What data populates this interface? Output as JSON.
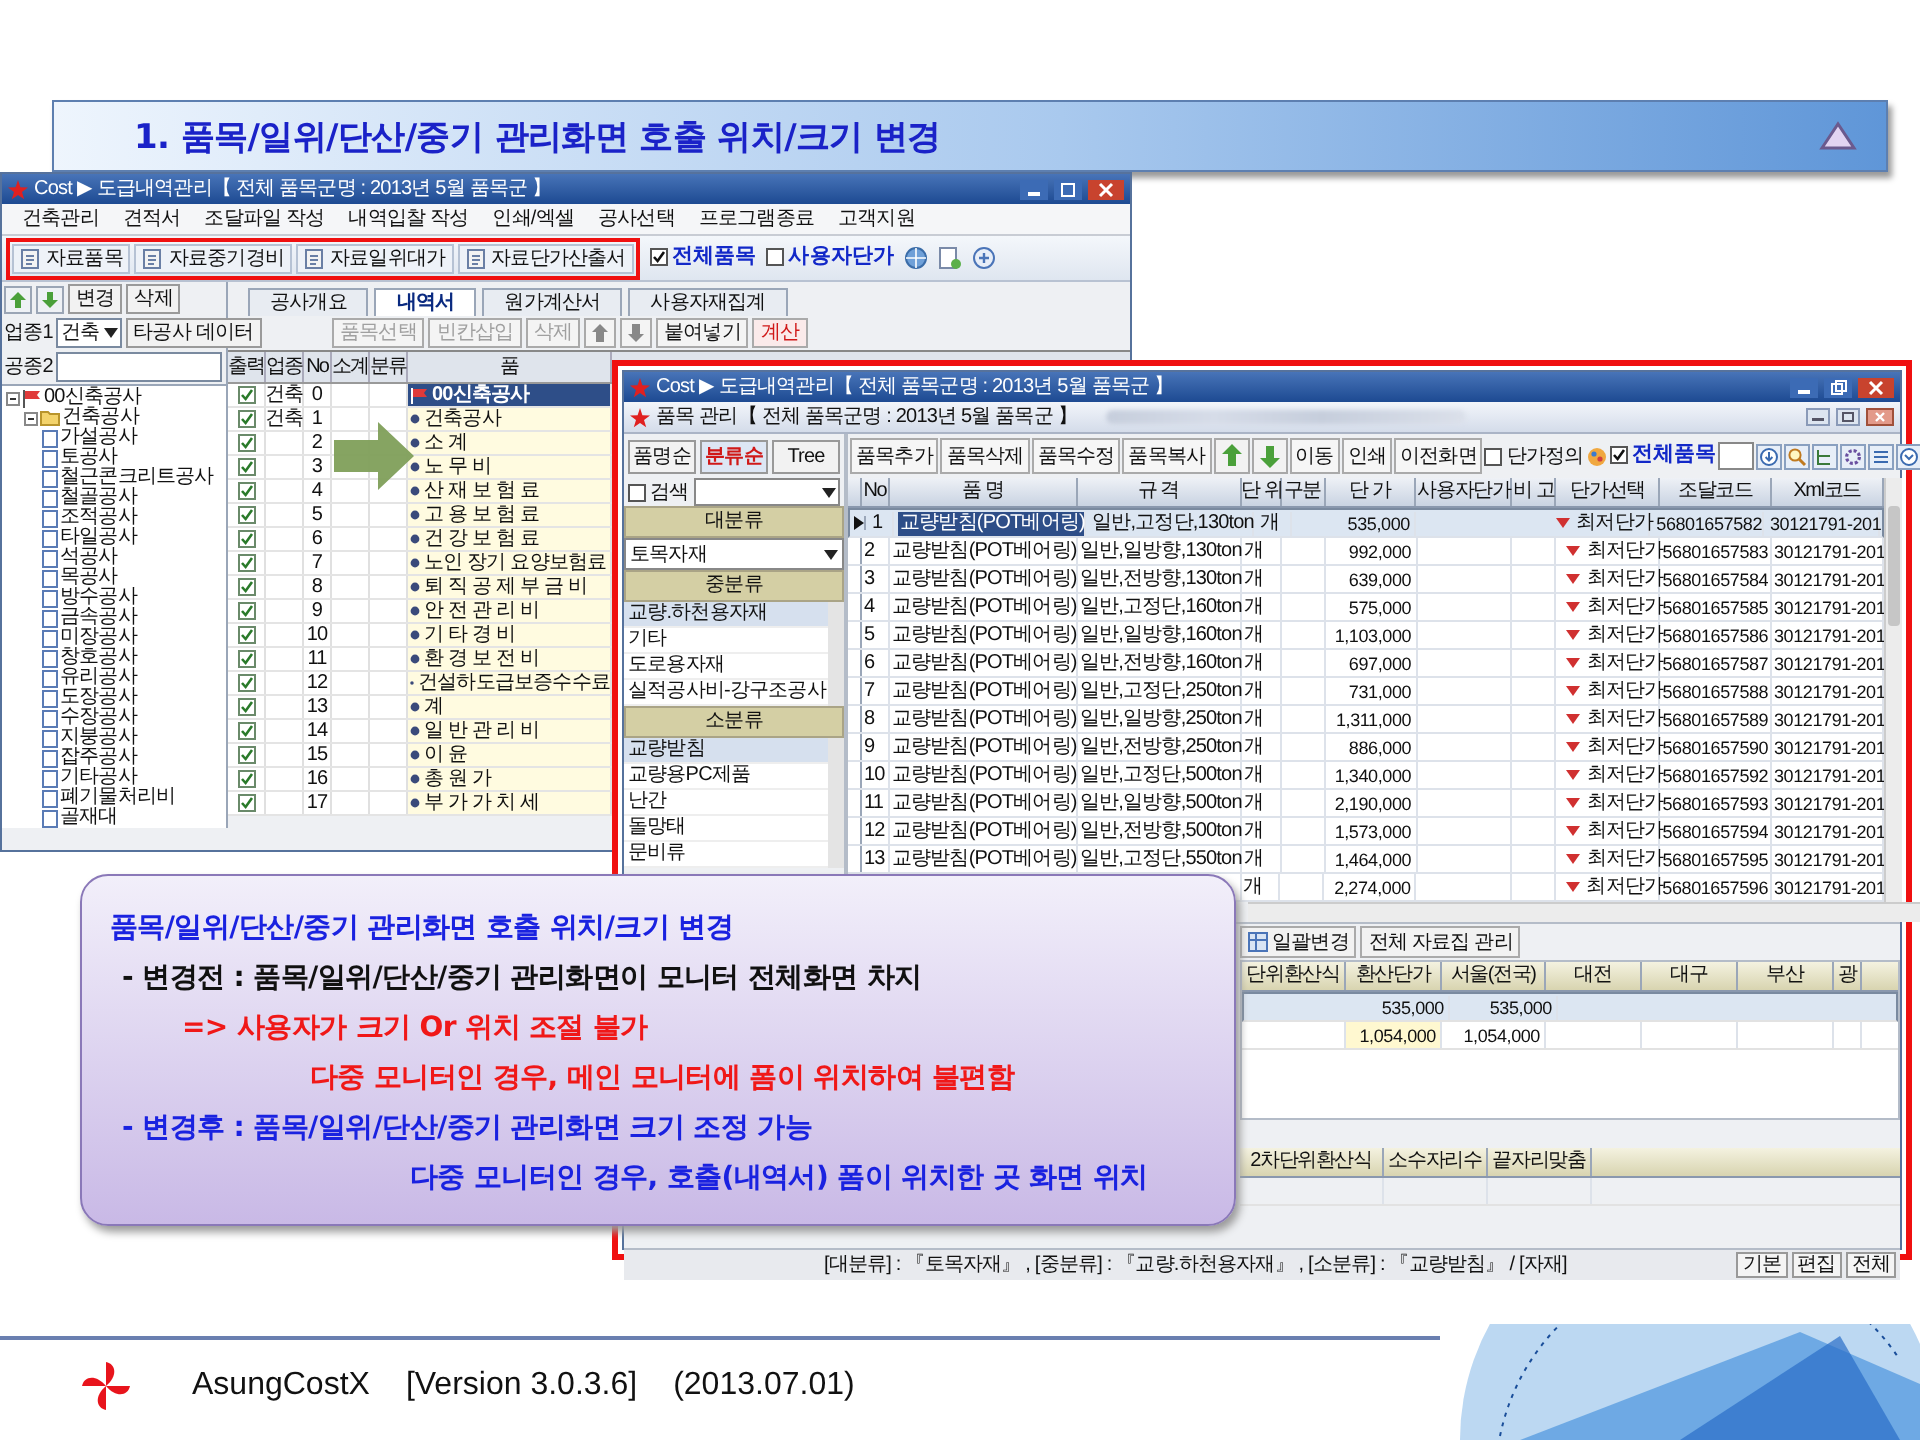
{
  "slide_title": "1. 품목/일위/단산/중기 관리화면 호출 위치/크기 변경",
  "back_window": {
    "title": "Cost ▶ 도급내역관리【 전체 품목군명 : 2013년 5월 품목군 】",
    "menu": [
      "건축관리",
      "견적서",
      "조달파일 작성",
      "내역입찰 작성",
      "인쇄/엑셀",
      "공사선택",
      "프로그램종료",
      "고객지원"
    ],
    "highlighted_buttons": [
      "자료품목",
      "자료중기경비",
      "자료일위대가",
      "자료단가산출서"
    ],
    "options": [
      {
        "label": "전체품목",
        "checked": true
      },
      {
        "label": "사용자단가",
        "checked": false
      }
    ],
    "side_buttons": [
      "변경",
      "삭제"
    ],
    "tabs": [
      {
        "label": "공사개요",
        "selected": false
      },
      {
        "label": "내역서",
        "selected": true
      },
      {
        "label": "원가계산서",
        "selected": false
      },
      {
        "label": "사용자재집계",
        "selected": false
      }
    ],
    "filter": {
      "label_1": "업종1",
      "value": "건축",
      "other_button": "타공사 데이터",
      "label_2": "공종2"
    },
    "grid_buttons": [
      {
        "kind": "button",
        "label": "품목선택",
        "disabled": true
      },
      {
        "kind": "button",
        "label": "빈칸삽입",
        "disabled": true
      },
      {
        "kind": "button",
        "label": "삭제",
        "disabled": true
      },
      {
        "kind": "up"
      },
      {
        "kind": "down"
      },
      {
        "kind": "button",
        "label": "붙여넣기",
        "disabled": false
      },
      {
        "kind": "accent",
        "label": "계산",
        "disabled": false
      }
    ],
    "tree": [
      {
        "label": "00신축공사",
        "expanded": true,
        "children": [
          {
            "label": "건축공사",
            "expanded": true,
            "children": [
              {
                "label": "가설공사"
              },
              {
                "label": "토공사"
              },
              {
                "label": "철근콘크리트공사"
              },
              {
                "label": "철골공사"
              },
              {
                "label": "조적공사"
              },
              {
                "label": "타일공사"
              },
              {
                "label": "석공사"
              },
              {
                "label": "목공사"
              },
              {
                "label": "방수공사"
              },
              {
                "label": "금속공사"
              },
              {
                "label": "미장공사"
              },
              {
                "label": "창호공사"
              },
              {
                "label": "유리공사"
              },
              {
                "label": "도장공사"
              },
              {
                "label": "수장공사"
              },
              {
                "label": "지붕공사"
              },
              {
                "label": "잡주공사"
              },
              {
                "label": "기타공사"
              },
              {
                "label": "폐기물처리비"
              },
              {
                "label": "골재대"
              }
            ]
          }
        ]
      }
    ],
    "grid": {
      "columns": [
        "출력",
        "업종",
        "No",
        "소계",
        "분류",
        "품"
      ],
      "rows": [
        {
          "kind": "project",
          "checked": true,
          "trade": "건축",
          "no": "0",
          "name": "00신축공사",
          "selected": true
        },
        {
          "kind": "item",
          "checked": true,
          "trade": "건축",
          "no": "1",
          "name": "건축공사",
          "selected": false
        },
        {
          "kind": "item",
          "checked": true,
          "no": "2",
          "name": "소 계",
          "selected": false
        },
        {
          "kind": "item",
          "checked": true,
          "no": "3",
          "name": "노 무 비",
          "selected": false
        },
        {
          "kind": "item",
          "checked": true,
          "no": "4",
          "name": "산 재 보 험 료",
          "selected": false
        },
        {
          "kind": "item",
          "checked": true,
          "no": "5",
          "name": "고 용 보 험 료",
          "selected": false
        },
        {
          "kind": "item",
          "checked": true,
          "no": "6",
          "name": "건 강 보 험 료",
          "selected": false
        },
        {
          "kind": "item",
          "checked": true,
          "no": "7",
          "name": "노인 장기 요양보험료",
          "selected": false
        },
        {
          "kind": "item",
          "checked": true,
          "no": "8",
          "name": "퇴 직 공 제 부 금 비",
          "selected": false
        },
        {
          "kind": "item",
          "checked": true,
          "no": "9",
          "name": "안 전 관 리 비",
          "selected": false
        },
        {
          "kind": "item",
          "checked": true,
          "no": "10",
          "name": "기 타 경 비",
          "selected": false
        },
        {
          "kind": "item",
          "checked": true,
          "no": "11",
          "name": "환 경 보 전 비",
          "selected": false
        },
        {
          "kind": "item",
          "checked": true,
          "no": "12",
          "name": "건설하도급보증수수료",
          "selected": false
        },
        {
          "kind": "item",
          "checked": true,
          "no": "13",
          "name": "계",
          "selected": false
        },
        {
          "kind": "item",
          "checked": true,
          "no": "14",
          "name": "일 반 관 리 비",
          "selected": false
        },
        {
          "kind": "item",
          "checked": true,
          "no": "15",
          "name": "이 윤",
          "selected": false
        },
        {
          "kind": "item",
          "checked": true,
          "no": "16",
          "name": "총 원 가",
          "selected": false
        },
        {
          "kind": "item",
          "checked": true,
          "no": "17",
          "name": "부 가 가 치 세",
          "selected": false
        }
      ]
    }
  },
  "front_window": {
    "title": "Cost ▶ 도급내역관리【 전체 품목군명 : 2013년 5월 품목군 】",
    "subtitle": "품목 관리【 전체 품목군명 : 2013년 5월 품목군 】",
    "sort_tabs": [
      {
        "label": "품명순",
        "selected": false
      },
      {
        "label": "분류순",
        "selected": true
      },
      {
        "label": "Tree",
        "selected": false
      }
    ],
    "search": {
      "label": "검색",
      "checked": false
    },
    "categories": [
      {
        "heading": "대분류",
        "kind": "dropdown",
        "value": "토목자재"
      },
      {
        "heading": "중분류",
        "kind": "list",
        "items": [
          {
            "label": "교량.하천용자재",
            "selected": true
          },
          {
            "label": "기타",
            "selected": false
          },
          {
            "label": "도로용자재",
            "selected": false
          },
          {
            "label": "실적공사비-강구조공사",
            "selected": false
          }
        ]
      },
      {
        "heading": "소분류",
        "kind": "list",
        "items": [
          {
            "label": "교량받침",
            "selected": true
          },
          {
            "label": "교량용PC제품",
            "selected": false
          },
          {
            "label": "난간",
            "selected": false
          },
          {
            "label": "돌망태",
            "selected": false
          },
          {
            "label": "문비류",
            "selected": false
          }
        ]
      }
    ],
    "toolbar": [
      {
        "kind": "button",
        "label": "품목추가"
      },
      {
        "kind": "button",
        "label": "품목삭제"
      },
      {
        "kind": "button",
        "label": "품목수정"
      },
      {
        "kind": "button",
        "label": "품목복사"
      },
      {
        "kind": "up"
      },
      {
        "kind": "down"
      },
      {
        "kind": "button",
        "label": "이동"
      },
      {
        "kind": "button",
        "label": "인쇄"
      },
      {
        "kind": "button",
        "label": "이전화면"
      }
    ],
    "options": [
      {
        "label": "단가정의",
        "checked": false
      },
      {
        "label": "전체품목",
        "checked": true
      }
    ],
    "grid": {
      "columns": [
        "No",
        "품 명",
        "규 격",
        "단 위",
        "구분",
        "단 가",
        "사용자단가",
        "비 고",
        "단가선택",
        "조달코드",
        "Xml코드"
      ],
      "rows": [
        {
          "no": "1",
          "name": "교량받침(POT베어링)",
          "spec": "일반,고정단,130ton",
          "unit": "개",
          "price": "535,000",
          "price_choice": "최저단가",
          "procurement_code": "56801657582",
          "xml_code": "30121791-201",
          "selected": true
        },
        {
          "no": "2",
          "name": "교량받침(POT베어링)",
          "spec": "일반,일방향,130ton",
          "unit": "개",
          "price": "992,000",
          "price_choice": "최저단가",
          "procurement_code": "56801657583",
          "xml_code": "30121791-201",
          "selected": false
        },
        {
          "no": "3",
          "name": "교량받침(POT베어링)",
          "spec": "일반,전방향,130ton",
          "unit": "개",
          "price": "639,000",
          "price_choice": "최저단가",
          "procurement_code": "56801657584",
          "xml_code": "30121791-201",
          "selected": false
        },
        {
          "no": "4",
          "name": "교량받침(POT베어링)",
          "spec": "일반,고정단,160ton",
          "unit": "개",
          "price": "575,000",
          "price_choice": "최저단가",
          "procurement_code": "56801657585",
          "xml_code": "30121791-201",
          "selected": false
        },
        {
          "no": "5",
          "name": "교량받침(POT베어링)",
          "spec": "일반,일방향,160ton",
          "unit": "개",
          "price": "1,103,000",
          "price_choice": "최저단가",
          "procurement_code": "56801657586",
          "xml_code": "30121791-201",
          "selected": false
        },
        {
          "no": "6",
          "name": "교량받침(POT베어링)",
          "spec": "일반,전방향,160ton",
          "unit": "개",
          "price": "697,000",
          "price_choice": "최저단가",
          "procurement_code": "56801657587",
          "xml_code": "30121791-201",
          "selected": false
        },
        {
          "no": "7",
          "name": "교량받침(POT베어링)",
          "spec": "일반,고정단,250ton",
          "unit": "개",
          "price": "731,000",
          "price_choice": "최저단가",
          "procurement_code": "56801657588",
          "xml_code": "30121791-201",
          "selected": false
        },
        {
          "no": "8",
          "name": "교량받침(POT베어링)",
          "spec": "일반,일방향,250ton",
          "unit": "개",
          "price": "1,311,000",
          "price_choice": "최저단가",
          "procurement_code": "56801657589",
          "xml_code": "30121791-201",
          "selected": false
        },
        {
          "no": "9",
          "name": "교량받침(POT베어링)",
          "spec": "일반,전방향,250ton",
          "unit": "개",
          "price": "886,000",
          "price_choice": "최저단가",
          "procurement_code": "56801657590",
          "xml_code": "30121791-201",
          "selected": false
        },
        {
          "no": "10",
          "name": "교량받침(POT베어링)",
          "spec": "일반,고정단,500ton",
          "unit": "개",
          "price": "1,340,000",
          "price_choice": "최저단가",
          "procurement_code": "56801657592",
          "xml_code": "30121791-201",
          "selected": false
        },
        {
          "no": "11",
          "name": "교량받침(POT베어링)",
          "spec": "일반,일방향,500ton",
          "unit": "개",
          "price": "2,190,000",
          "price_choice": "최저단가",
          "procurement_code": "56801657593",
          "xml_code": "30121791-201",
          "selected": false
        },
        {
          "no": "12",
          "name": "교량받침(POT베어링)",
          "spec": "일반,전방향,500ton",
          "unit": "개",
          "price": "1,573,000",
          "price_choice": "최저단가",
          "procurement_code": "56801657594",
          "xml_code": "30121791-201",
          "selected": false
        },
        {
          "no": "13",
          "name": "교량받침(POT베어링)",
          "spec": "일반,고정단,550ton",
          "unit": "개",
          "price": "1,464,000",
          "price_choice": "최저단가",
          "procurement_code": "56801657595",
          "xml_code": "30121791-201",
          "selected": false
        },
        {
          "unit": "개",
          "price": "2,274,000",
          "price_choice": "최저단가",
          "procurement_code": "56801657596",
          "xml_code": "30121791-201",
          "selected": false
        }
      ]
    },
    "lower_tabs": [
      "일괄변경",
      "전체 자료집 관리"
    ],
    "price_grid": {
      "columns": [
        "단위환산식",
        "환산단가",
        "서울(전국)",
        "대전",
        "대구",
        "부산",
        "광"
      ],
      "rows": [
        {
          "converted_price": "535,000",
          "seoul": "535,000",
          "selected": true
        },
        {
          "converted_price": "1,054,000",
          "seoul": "1,054,000",
          "selected": false
        }
      ]
    },
    "format_grid": {
      "columns": [
        "2차단위환산식",
        "소수자리수",
        "끝자리맞춤"
      ]
    },
    "status": "[대분류] : 『토목자재』 , [중분류] : 『교량.하천용자재』 , [소분류] : 『교량받침』 / [자재]",
    "view_buttons": [
      "기본",
      "편집",
      "전체"
    ]
  },
  "callout": [
    {
      "kind": "title",
      "text": "품목/일위/단산/중기 관리화면 호출 위치/크기 변경"
    },
    {
      "kind": "before",
      "text": "- 변경전 : 품목/일위/단산/중기 관리화면이 모니터 전체화면 차지"
    },
    {
      "kind": "problem",
      "text": "=> 사용자가 크기 Or 위치 조절 불가"
    },
    {
      "kind": "problem_detail",
      "text": "다중 모니터인 경우, 메인 모니터에 폼이 위치하여 불편함"
    },
    {
      "kind": "after",
      "text": "- 변경후 : 품목/일위/단산/중기 관리화면 크기 조정 가능"
    },
    {
      "kind": "after_detail",
      "text": "다중 모니터인 경우, 호출(내역서) 폼이 위치한 곳 화면 위치"
    }
  ],
  "footer": {
    "product": "AsungCostX",
    "version": "[Version 3.0.3.6]",
    "date": "(2013.07.01)"
  }
}
